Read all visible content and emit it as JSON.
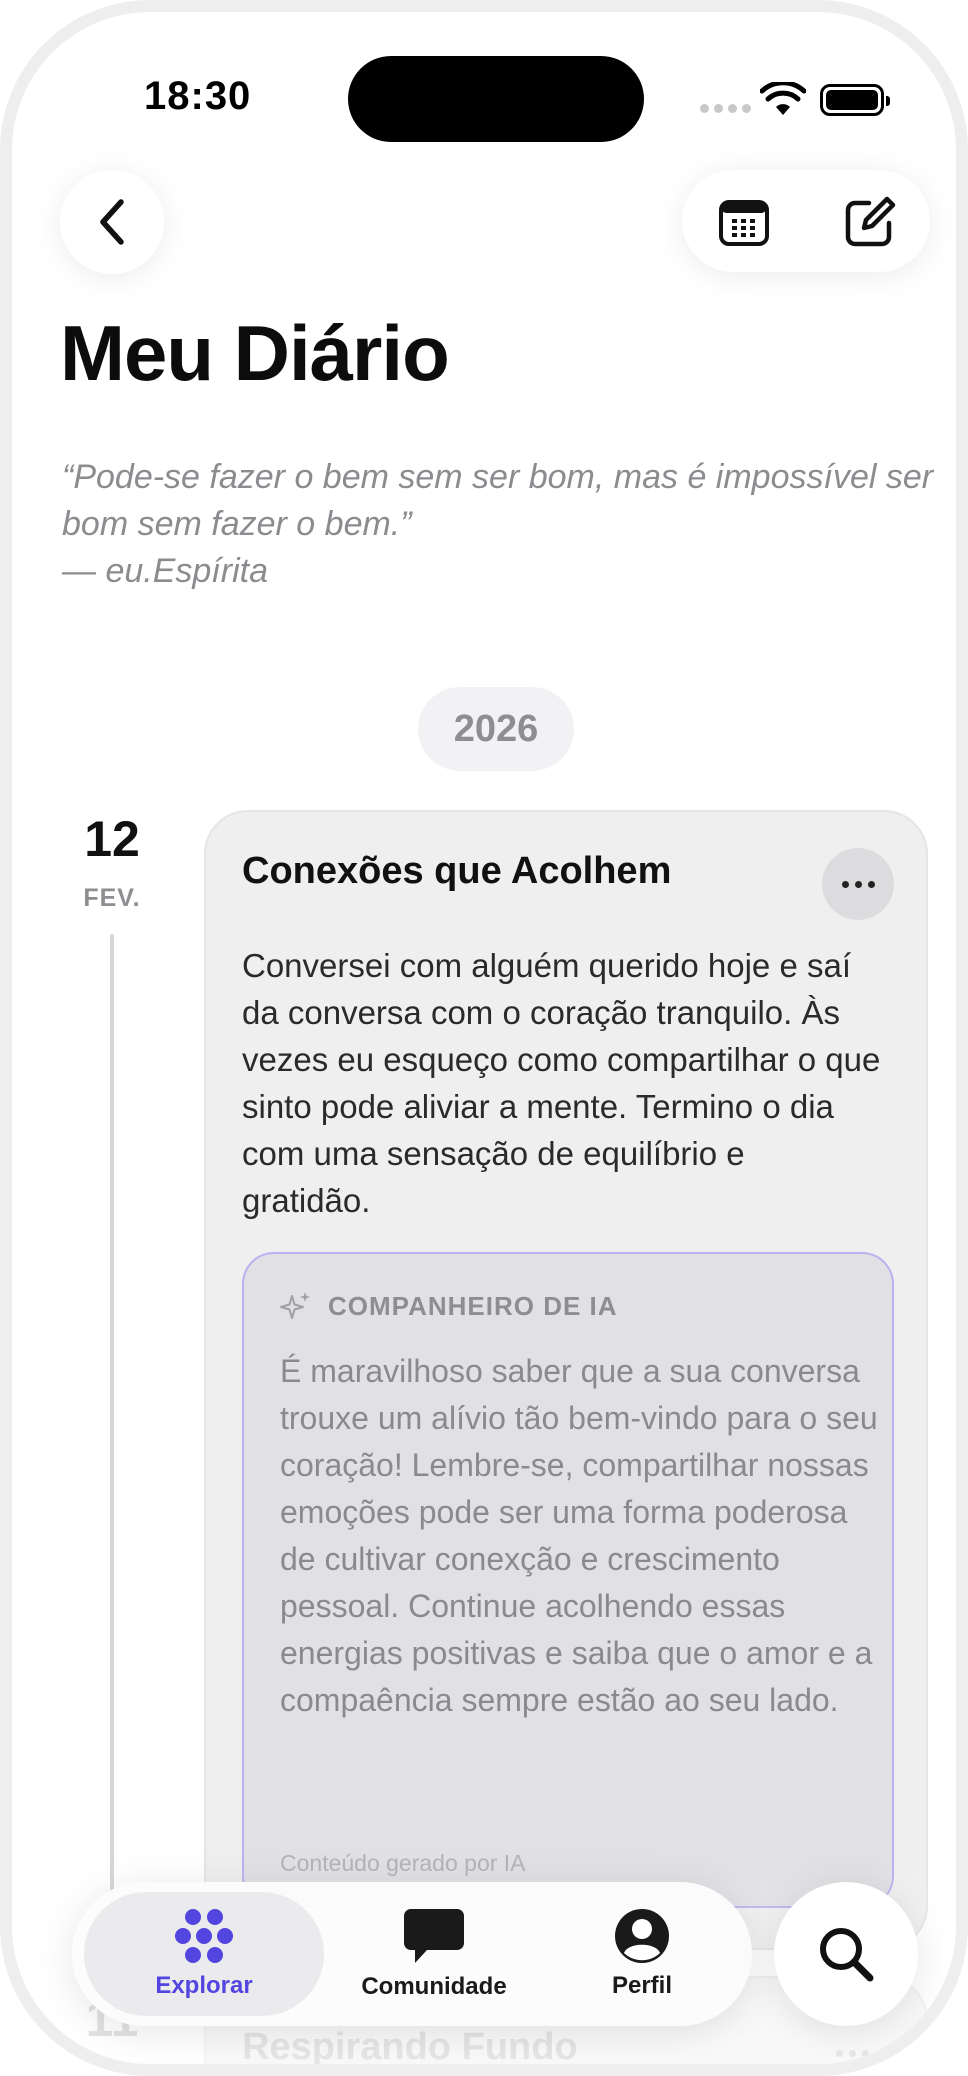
{
  "status_bar": {
    "time": "18:30"
  },
  "header": {
    "title": "Meu Diário"
  },
  "quote": {
    "text": "“Pode-se fazer o bem sem ser bom, mas é impossível ser bom sem fazer o bem.”",
    "author": "— eu.Espírita"
  },
  "year": "2026",
  "entries": [
    {
      "day": "12",
      "month": "FEV.",
      "title": "Conexões que Acolhem",
      "text": "Conversei com alguém querido hoje e saí da conversa com o coração tranquilo. Às vezes eu esqueço como compartilhar o que sinto pode aliviar a mente. Termino o dia com uma sensação de equilíbrio e gratidão.",
      "ai": {
        "label": "COMPANHEIRO DE IA",
        "text": "É maravilhoso saber que a sua conversa trouxe um alívio tão bem-vindo para o seu coração! Lembre-se, compartilhar nossas emoções pode ser uma forma poderosa de cultivar conexção e crescimento pessoal. Continue acolhendo essas energias positivas e saiba que o amor e a compaência sempre estão ao seu lado.",
        "footer": "Conteúdo gerado por IA"
      }
    },
    {
      "day": "11",
      "title": "Respirando Fundo"
    }
  ],
  "tabbar": {
    "items": [
      {
        "label": "Explorar",
        "icon": "explore-dots-icon",
        "active": true
      },
      {
        "label": "Comunidade",
        "icon": "chat-bubble-icon",
        "active": false
      },
      {
        "label": "Perfil",
        "icon": "person-icon",
        "active": false
      }
    ],
    "search_icon": "search-icon"
  },
  "colors": {
    "accent": "#5346e0",
    "ai_border": "#b8b3f0",
    "card_bg": "#efeff0"
  }
}
